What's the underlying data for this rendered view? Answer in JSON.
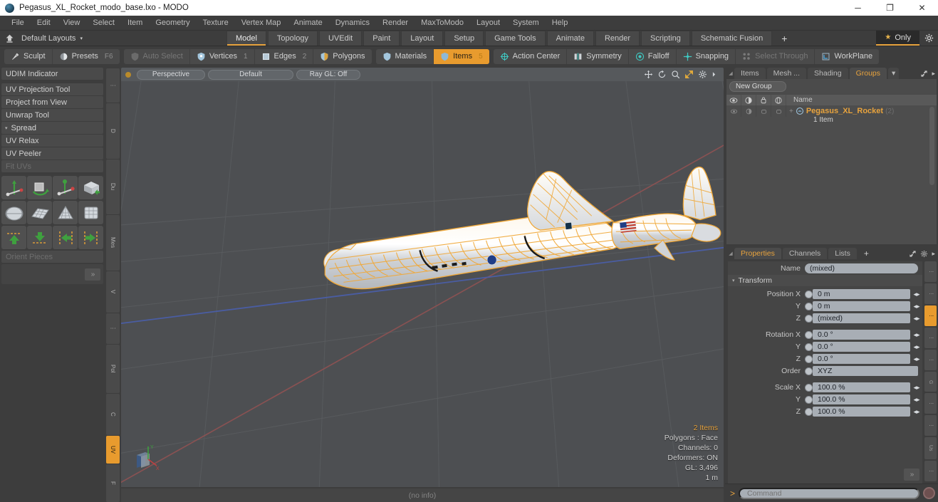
{
  "window": {
    "title": "Pegasus_XL_Rocket_modo_base.lxo - MODO",
    "app_icon": "modo-app-icon",
    "minimize": "─",
    "maximize": "❐",
    "close": "✕"
  },
  "menubar": {
    "items": [
      "File",
      "Edit",
      "View",
      "Select",
      "Item",
      "Geometry",
      "Texture",
      "Vertex Map",
      "Animate",
      "Dynamics",
      "Render",
      "MaxToModo",
      "Layout",
      "System",
      "Help"
    ]
  },
  "layoutbar": {
    "home_icon": "home-icon",
    "default_layouts": "Default Layouts",
    "caret": "▾",
    "tabs": [
      {
        "label": "Model",
        "active": true
      },
      {
        "label": "Topology",
        "active": false
      },
      {
        "label": "UVEdit",
        "active": false
      },
      {
        "label": "Paint",
        "active": false
      },
      {
        "label": "Layout",
        "active": false
      },
      {
        "label": "Setup",
        "active": false
      },
      {
        "label": "Game Tools",
        "active": false
      },
      {
        "label": "Animate",
        "active": false
      },
      {
        "label": "Render",
        "active": false
      },
      {
        "label": "Scripting",
        "active": false
      },
      {
        "label": "Schematic Fusion",
        "active": false
      }
    ],
    "add_tab": "+",
    "only_label": "Only",
    "only_star": "★",
    "gear": "gear-icon"
  },
  "modebar": {
    "group1": [
      {
        "label": "Sculpt",
        "icon": "brush-icon",
        "state": "normal"
      },
      {
        "label": "Presets",
        "icon": "sphere-icon",
        "state": "normal",
        "shortcut": "F6"
      }
    ],
    "group2": [
      {
        "label": "Auto Select",
        "icon": "shield-icon",
        "state": "dim",
        "num": ""
      },
      {
        "label": "Vertices",
        "icon": "vertex-icon",
        "state": "normal",
        "num": "1"
      },
      {
        "label": "Edges",
        "icon": "edge-icon",
        "state": "normal",
        "num": "2"
      },
      {
        "label": "Polygons",
        "icon": "polygon-icon",
        "state": "normal",
        "num": ""
      }
    ],
    "group3": [
      {
        "label": "Materials",
        "icon": "material-icon",
        "state": "normal",
        "num": ""
      },
      {
        "label": "Items",
        "icon": "item-icon",
        "state": "selected",
        "num": "5"
      }
    ],
    "group4": [
      {
        "label": "Action Center",
        "icon": "crosshair-icon",
        "state": "normal"
      },
      {
        "label": "Symmetry",
        "icon": "symmetry-icon",
        "state": "normal"
      },
      {
        "label": "Falloff",
        "icon": "falloff-icon",
        "state": "normal"
      },
      {
        "label": "Snapping",
        "icon": "snap-icon",
        "state": "normal"
      },
      {
        "label": "Select Through",
        "icon": "select-through-icon",
        "state": "dim"
      },
      {
        "label": "WorkPlane",
        "icon": "workplane-icon",
        "state": "normal"
      }
    ]
  },
  "left_panel": {
    "rows": [
      {
        "label": "UDIM Indicator",
        "dim": false,
        "gap_after": true
      },
      {
        "label": "UV Projection Tool",
        "dim": false,
        "gap_after": false
      },
      {
        "label": "Project from View",
        "dim": false,
        "gap_after": false
      },
      {
        "label": "Unwrap Tool",
        "dim": false,
        "gap_after": false
      }
    ],
    "section": {
      "label": "Spread",
      "tri": "▾"
    },
    "rows2": [
      {
        "label": "UV Relax",
        "dim": false
      },
      {
        "label": "UV Peeler",
        "dim": false
      },
      {
        "label": "Fit UVs",
        "dim": true
      }
    ],
    "icon_rows": [
      [
        "move-uv-icon",
        "rotate-uv-icon",
        "scale-uv-icon",
        "unwrap-box-icon"
      ],
      [
        "sphere-map-icon",
        "grid-map-icon",
        "cone-map-icon",
        "cylinder-map-icon"
      ],
      [
        "flip-up-icon",
        "flip-down-icon",
        "flip-left-icon",
        "flip-right-icon"
      ]
    ],
    "orient_pieces": "Orient Pieces",
    "chevron": "»",
    "vtabs": [
      {
        "label": "⋮",
        "active": false
      },
      {
        "label": "D",
        "active": false
      },
      {
        "label": "Du",
        "active": false
      },
      {
        "label": "Mes",
        "active": false
      },
      {
        "label": "V",
        "active": false
      },
      {
        "label": "⋮",
        "active": false
      },
      {
        "label": "Pol",
        "active": false
      },
      {
        "label": "C",
        "active": false
      },
      {
        "label": "UV",
        "active": true
      },
      {
        "label": "F",
        "active": false
      }
    ]
  },
  "viewport": {
    "dot": "viewport-indicator",
    "pills": [
      {
        "label": "Perspective"
      },
      {
        "label": "Default"
      },
      {
        "label": "Ray GL: Off"
      }
    ],
    "icons": [
      "move-tool-icon",
      "rotate-tool-icon",
      "zoom-tool-icon",
      "fit-tool-icon",
      "viewport-gear-icon",
      "viewport-more-icon"
    ],
    "info": [
      {
        "text": "2 Items",
        "accent": true
      },
      {
        "text": "Polygons : Face",
        "accent": false
      },
      {
        "text": "Channels: 0",
        "accent": false
      },
      {
        "text": "Deformers: ON",
        "accent": false
      },
      {
        "text": "GL: 3,496",
        "accent": false
      },
      {
        "text": "1 m",
        "accent": false
      }
    ],
    "axis": {
      "x": "X",
      "y": "Y",
      "z": "Z"
    },
    "model_name": "Pegasus XL Rocket wireframe model"
  },
  "statusbar": {
    "text": "(no info)"
  },
  "right_panel": {
    "tabs": [
      {
        "label": "Items",
        "active": false
      },
      {
        "label": "Mesh ...",
        "active": false
      },
      {
        "label": "Shading",
        "active": false
      },
      {
        "label": "Groups",
        "active": true
      }
    ],
    "tab_caret": "▾",
    "expand_icon": "expand-icon",
    "more_icon": "▸",
    "new_group": "New Group",
    "tree_headers": {
      "visibility": "eye-icon",
      "render": "render-icon",
      "lock": "lock-icon",
      "wire": "wireframe-icon",
      "name": "Name"
    },
    "tree_rows": [
      {
        "name": "Pegasus_XL_Rocket",
        "count": "(2)",
        "sub": "1 Item",
        "plus": "+"
      }
    ]
  },
  "properties": {
    "tabs": [
      {
        "label": "Properties",
        "active": true
      },
      {
        "label": "Channels",
        "active": false
      },
      {
        "label": "Lists",
        "active": false
      },
      {
        "label": "+",
        "active": false
      }
    ],
    "expand_icon": "expand-icon",
    "gear_icon": "gear-icon",
    "more_icon": "▸",
    "name_label": "Name",
    "name_value": "(mixed)",
    "transform_section": "Transform",
    "fields": [
      {
        "label": "Position X",
        "value": "0 m",
        "type": "num"
      },
      {
        "label": "Y",
        "value": "0 m",
        "type": "num"
      },
      {
        "label": "Z",
        "value": "(mixed)",
        "type": "num"
      },
      {
        "label": "Rotation X",
        "value": "0.0 °",
        "type": "num"
      },
      {
        "label": "Y",
        "value": "0.0 °",
        "type": "num"
      },
      {
        "label": "Z",
        "value": "0.0 °",
        "type": "num"
      },
      {
        "label": "Order",
        "value": "XYZ",
        "type": "select"
      },
      {
        "label": "Scale X",
        "value": "100.0 %",
        "type": "num"
      },
      {
        "label": "Y",
        "value": "100.0 %",
        "type": "num"
      },
      {
        "label": "Z",
        "value": "100.0 %",
        "type": "num"
      }
    ],
    "chevron": "»",
    "vtabs": [
      {
        "label": "⋮",
        "active": false
      },
      {
        "label": "⋮",
        "active": false
      },
      {
        "label": "⋮",
        "active": true
      },
      {
        "label": "⋮",
        "active": false
      },
      {
        "label": "⋮",
        "active": false
      },
      {
        "label": "G",
        "active": false
      },
      {
        "label": "⋮",
        "active": false
      },
      {
        "label": "⋮",
        "active": false
      },
      {
        "label": "Us",
        "active": false
      },
      {
        "label": "⋮",
        "active": false
      }
    ]
  },
  "command": {
    "prompt": ">",
    "placeholder": "Command",
    "record_icon": "record-icon"
  },
  "colors": {
    "accent": "#e8a33d",
    "selected": "#e89b2e",
    "panel_bg": "#3d3d3d",
    "field_bg": "#a8aeb5",
    "viewport_bg": "#4d4f52",
    "mesh_wire": "#f0a838"
  }
}
